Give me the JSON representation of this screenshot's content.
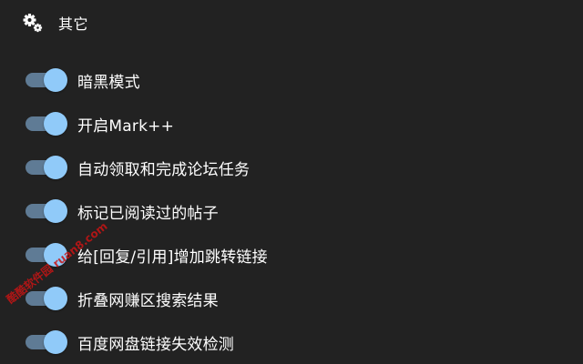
{
  "section": {
    "title": "其它",
    "icon": "gears-icon"
  },
  "colors": {
    "background": "#222222",
    "toggle_track_on": "#5f7b95",
    "toggle_thumb_on": "#90caf9",
    "text": "#ffffff"
  },
  "settings": [
    {
      "label": "暗黑模式",
      "enabled": true
    },
    {
      "label": "开启Mark++",
      "enabled": true
    },
    {
      "label": "自动领取和完成论坛任务",
      "enabled": true
    },
    {
      "label": "标记已阅读过的帖子",
      "enabled": true
    },
    {
      "label": "给[回复/引用]增加跳转链接",
      "enabled": true
    },
    {
      "label": "折叠网赚区搜索结果",
      "enabled": true
    },
    {
      "label": "百度网盘链接失效检测",
      "enabled": true
    }
  ],
  "watermark": {
    "text": "酷酷软件园 ruan8.com"
  }
}
